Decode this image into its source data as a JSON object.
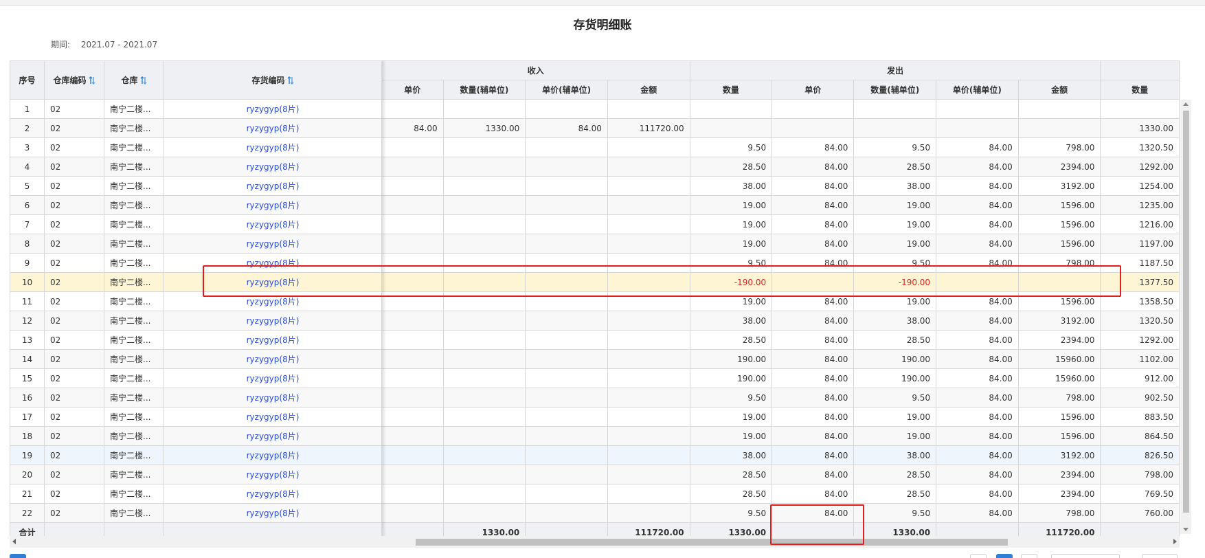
{
  "title": "存货明细账",
  "period": {
    "label": "期间:",
    "value": "2021.07 - 2021.07"
  },
  "headers": {
    "seq": "序号",
    "warehouse_code": "仓库编码",
    "warehouse": "仓库",
    "item_code": "存货编码",
    "income_group": "收入",
    "issue_group": "发出",
    "income_cols": [
      "单价",
      "数量(辅单位)",
      "单价(辅单位)",
      "金额"
    ],
    "issue_cols": [
      "数量",
      "单价",
      "数量(辅单位)",
      "单价(辅单位)",
      "金额"
    ],
    "balance_col": "数量"
  },
  "rows": [
    {
      "seq": "1",
      "wcode": "02",
      "wname": "南宁二楼...",
      "code": "ryzygyp(8片)",
      "in": [
        "",
        "",
        "",
        ""
      ],
      "out": [
        "",
        "",
        "",
        "",
        ""
      ],
      "bal": ""
    },
    {
      "seq": "2",
      "wcode": "02",
      "wname": "南宁二楼...",
      "code": "ryzygyp(8片)",
      "in": [
        "84.00",
        "1330.00",
        "84.00",
        "111720.00"
      ],
      "out": [
        "",
        "",
        "",
        "",
        ""
      ],
      "bal": "1330.00"
    },
    {
      "seq": "3",
      "wcode": "02",
      "wname": "南宁二楼...",
      "code": "ryzygyp(8片)",
      "in": [
        "",
        "",
        "",
        ""
      ],
      "out": [
        "9.50",
        "84.00",
        "9.50",
        "84.00",
        "798.00"
      ],
      "bal": "1320.50"
    },
    {
      "seq": "4",
      "wcode": "02",
      "wname": "南宁二楼...",
      "code": "ryzygyp(8片)",
      "in": [
        "",
        "",
        "",
        ""
      ],
      "out": [
        "28.50",
        "84.00",
        "28.50",
        "84.00",
        "2394.00"
      ],
      "bal": "1292.00"
    },
    {
      "seq": "5",
      "wcode": "02",
      "wname": "南宁二楼...",
      "code": "ryzygyp(8片)",
      "in": [
        "",
        "",
        "",
        ""
      ],
      "out": [
        "38.00",
        "84.00",
        "38.00",
        "84.00",
        "3192.00"
      ],
      "bal": "1254.00"
    },
    {
      "seq": "6",
      "wcode": "02",
      "wname": "南宁二楼...",
      "code": "ryzygyp(8片)",
      "in": [
        "",
        "",
        "",
        ""
      ],
      "out": [
        "19.00",
        "84.00",
        "19.00",
        "84.00",
        "1596.00"
      ],
      "bal": "1235.00"
    },
    {
      "seq": "7",
      "wcode": "02",
      "wname": "南宁二楼...",
      "code": "ryzygyp(8片)",
      "in": [
        "",
        "",
        "",
        ""
      ],
      "out": [
        "19.00",
        "84.00",
        "19.00",
        "84.00",
        "1596.00"
      ],
      "bal": "1216.00"
    },
    {
      "seq": "8",
      "wcode": "02",
      "wname": "南宁二楼...",
      "code": "ryzygyp(8片)",
      "in": [
        "",
        "",
        "",
        ""
      ],
      "out": [
        "19.00",
        "84.00",
        "19.00",
        "84.00",
        "1596.00"
      ],
      "bal": "1197.00"
    },
    {
      "seq": "9",
      "wcode": "02",
      "wname": "南宁二楼...",
      "code": "ryzygyp(8片)",
      "in": [
        "",
        "",
        "",
        ""
      ],
      "out": [
        "9.50",
        "84.00",
        "9.50",
        "84.00",
        "798.00"
      ],
      "bal": "1187.50"
    },
    {
      "seq": "10",
      "wcode": "02",
      "wname": "南宁二楼...",
      "code": "ryzygyp(8片)",
      "in": [
        "",
        "",
        "",
        ""
      ],
      "out": [
        "-190.00",
        "",
        "-190.00",
        "",
        ""
      ],
      "bal": "1377.50"
    },
    {
      "seq": "11",
      "wcode": "02",
      "wname": "南宁二楼...",
      "code": "ryzygyp(8片)",
      "in": [
        "",
        "",
        "",
        ""
      ],
      "out": [
        "19.00",
        "84.00",
        "19.00",
        "84.00",
        "1596.00"
      ],
      "bal": "1358.50"
    },
    {
      "seq": "12",
      "wcode": "02",
      "wname": "南宁二楼...",
      "code": "ryzygyp(8片)",
      "in": [
        "",
        "",
        "",
        ""
      ],
      "out": [
        "38.00",
        "84.00",
        "38.00",
        "84.00",
        "3192.00"
      ],
      "bal": "1320.50"
    },
    {
      "seq": "13",
      "wcode": "02",
      "wname": "南宁二楼...",
      "code": "ryzygyp(8片)",
      "in": [
        "",
        "",
        "",
        ""
      ],
      "out": [
        "28.50",
        "84.00",
        "28.50",
        "84.00",
        "2394.00"
      ],
      "bal": "1292.00"
    },
    {
      "seq": "14",
      "wcode": "02",
      "wname": "南宁二楼...",
      "code": "ryzygyp(8片)",
      "in": [
        "",
        "",
        "",
        ""
      ],
      "out": [
        "190.00",
        "84.00",
        "190.00",
        "84.00",
        "15960.00"
      ],
      "bal": "1102.00"
    },
    {
      "seq": "15",
      "wcode": "02",
      "wname": "南宁二楼...",
      "code": "ryzygyp(8片)",
      "in": [
        "",
        "",
        "",
        ""
      ],
      "out": [
        "190.00",
        "84.00",
        "190.00",
        "84.00",
        "15960.00"
      ],
      "bal": "912.00"
    },
    {
      "seq": "16",
      "wcode": "02",
      "wname": "南宁二楼...",
      "code": "ryzygyp(8片)",
      "in": [
        "",
        "",
        "",
        ""
      ],
      "out": [
        "9.50",
        "84.00",
        "9.50",
        "84.00",
        "798.00"
      ],
      "bal": "902.50"
    },
    {
      "seq": "17",
      "wcode": "02",
      "wname": "南宁二楼...",
      "code": "ryzygyp(8片)",
      "in": [
        "",
        "",
        "",
        ""
      ],
      "out": [
        "19.00",
        "84.00",
        "19.00",
        "84.00",
        "1596.00"
      ],
      "bal": "883.50"
    },
    {
      "seq": "18",
      "wcode": "02",
      "wname": "南宁二楼...",
      "code": "ryzygyp(8片)",
      "in": [
        "",
        "",
        "",
        ""
      ],
      "out": [
        "19.00",
        "84.00",
        "19.00",
        "84.00",
        "1596.00"
      ],
      "bal": "864.50"
    },
    {
      "seq": "19",
      "wcode": "02",
      "wname": "南宁二楼...",
      "code": "ryzygyp(8片)",
      "in": [
        "",
        "",
        "",
        ""
      ],
      "out": [
        "38.00",
        "84.00",
        "38.00",
        "84.00",
        "3192.00"
      ],
      "bal": "826.50"
    },
    {
      "seq": "20",
      "wcode": "02",
      "wname": "南宁二楼...",
      "code": "ryzygyp(8片)",
      "in": [
        "",
        "",
        "",
        ""
      ],
      "out": [
        "28.50",
        "84.00",
        "28.50",
        "84.00",
        "2394.00"
      ],
      "bal": "798.00"
    },
    {
      "seq": "21",
      "wcode": "02",
      "wname": "南宁二楼...",
      "code": "ryzygyp(8片)",
      "in": [
        "",
        "",
        "",
        ""
      ],
      "out": [
        "28.50",
        "84.00",
        "28.50",
        "84.00",
        "2394.00"
      ],
      "bal": "769.50"
    },
    {
      "seq": "22",
      "wcode": "02",
      "wname": "南宁二楼...",
      "code": "ryzygyp(8片)",
      "in": [
        "",
        "",
        "",
        ""
      ],
      "out": [
        "9.50",
        "84.00",
        "9.50",
        "84.00",
        "798.00"
      ],
      "bal": "760.00"
    }
  ],
  "totals": {
    "label": "合计",
    "in": [
      "",
      "1330.00",
      "",
      "111720.00"
    ],
    "out": [
      "1330.00",
      "",
      "1330.00",
      "",
      "111720.00"
    ],
    "bal": ""
  },
  "highlight_row": "10",
  "hover_row": "19",
  "colors": {
    "link": "#2a4cd6",
    "negative": "#e02020",
    "highlight": "#fdf5d3",
    "annotation": "#e41c1c",
    "accent": "#2f7fd8"
  },
  "icons": {
    "sort": "sort-arrows-icon"
  }
}
